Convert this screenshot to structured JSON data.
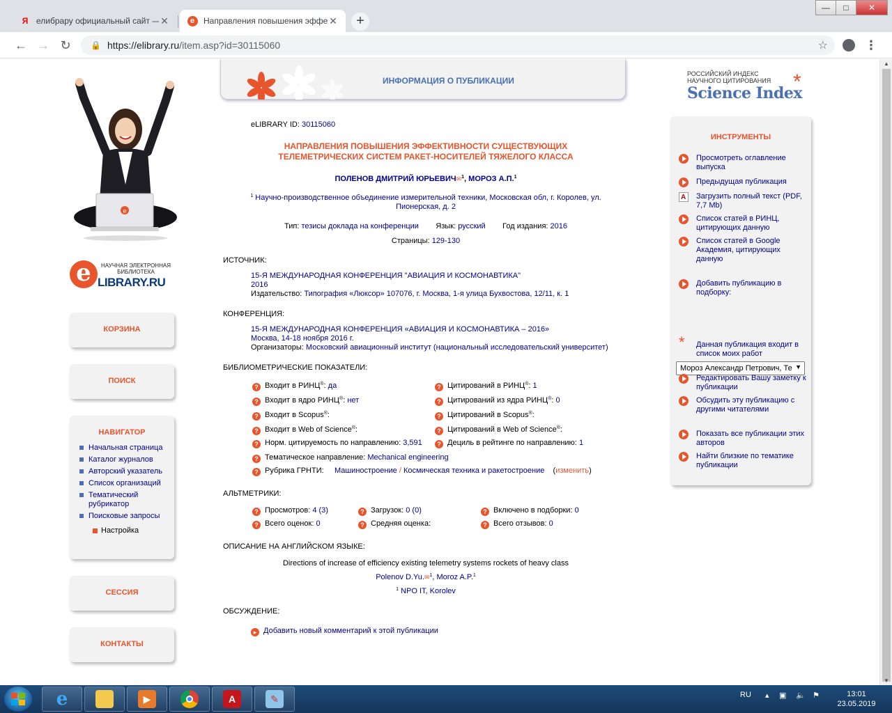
{
  "browser": {
    "tabs": [
      {
        "title": "елибрару официальный сайт — Ян",
        "favicon": "yandex-icon",
        "active": false
      },
      {
        "title": "Направления повышения эффекти",
        "favicon": "elibrary-icon",
        "active": true
      }
    ],
    "new_tab": "+",
    "url_host": "https://elibrary.ru",
    "url_path": "/item.asp?id=30115060",
    "window_controls": {
      "minimize": "—",
      "maximize": "□",
      "close": "✕"
    }
  },
  "left": {
    "logo_small": "НАУЧНАЯ ЭЛЕКТРОННАЯ БИБЛИОТЕКА",
    "logo_letter": "e",
    "logo_big": "LIBRARY.RU",
    "cart": "КОРЗИНА",
    "search": "ПОИСК",
    "navigator": {
      "title": "НАВИГАТОР",
      "items": [
        "Начальная страница",
        "Каталог журналов",
        "Авторский указатель",
        "Список организаций",
        "Тематический рубрикатор",
        "Поисковые запросы"
      ],
      "settings": "Настройка"
    },
    "session": "СЕССИЯ",
    "contacts": "КОНТАКТЫ"
  },
  "header": {
    "title": "ИНФОРМАЦИЯ О ПУБЛИКАЦИИ"
  },
  "publication": {
    "id_label": "eLIBRARY ID:",
    "id": "30115060",
    "title_line1": "НАПРАВЛЕНИЯ ПОВЫШЕНИЯ ЭФФЕКТИВНОСТИ СУЩЕСТВУЮЩИХ",
    "title_line2": "ТЕЛЕМЕТРИЧЕСКИХ СИСТЕМ РАКЕТ-НОСИТЕЛЕЙ ТЯЖЕЛОГО КЛАССА",
    "author1": "ПОЛЕНОВ ДМИТРИЙ ЮРЬЕВИЧ",
    "author1_sup": "1",
    "author2": "МОРОЗ А.П.",
    "author2_sup": "1",
    "affil_sup": "1",
    "affil_line1": "Научно-производственное объединение измерительной техники, Московская обл, г. Королев, ул.",
    "affil_line2": "Пионерская, д. 2",
    "type_label": "Тип:",
    "type": "тезисы доклада на конференции",
    "lang_label": "Язык:",
    "lang": "русский",
    "year_label": "Год издания:",
    "year": "2016",
    "pages_label": "Страницы:",
    "pages": "129-130"
  },
  "source": {
    "heading": "ИСТОЧНИК:",
    "name": "15-Я МЕЖДУНАРОДНАЯ КОНФЕРЕНЦИЯ \"АВИАЦИЯ И КОСМОНАВТИКА\"",
    "year": "2016",
    "publisher_label": "Издательство:",
    "publisher": "Типография «Люксор» 107076, г. Москва, 1-я улица Бухвостова, 12/11, к. 1"
  },
  "conference": {
    "heading": "КОНФЕРЕНЦИЯ:",
    "name": "15-Я МЕЖДУНАРОДНАЯ КОНФЕРЕНЦИЯ «АВИАЦИЯ И КОСМОНАВТИКА – 2016»",
    "place": "Москва, 14-18 ноября 2016 г.",
    "org_label": "Организаторы:",
    "org": "Московский авиационный институт (национальный исследовательский университет)"
  },
  "biblio": {
    "heading": "БИБЛИОМЕТРИЧЕСКИЕ ПОКАЗАТЕЛИ:",
    "left": [
      {
        "label": "Входит в РИНЦ",
        "sup": "®",
        "value": "да"
      },
      {
        "label": "Входит в ядро РИНЦ",
        "sup": "®",
        "value": "нет"
      },
      {
        "label": "Входит в Scopus",
        "sup": "®",
        "value": ""
      },
      {
        "label": "Входит в Web of Science",
        "sup": "®",
        "value": ""
      },
      {
        "label": "Норм. цитируемость по направлению:",
        "sup": "",
        "value": "3,591"
      }
    ],
    "right": [
      {
        "label": "Цитирований в РИНЦ",
        "sup": "®",
        "value": "1"
      },
      {
        "label": "Цитирований из ядра РИНЦ",
        "sup": "®",
        "value": "0"
      },
      {
        "label": "Цитирований в Scopus",
        "sup": "®",
        "value": ""
      },
      {
        "label": "Цитирований в Web of Science",
        "sup": "®",
        "value": ""
      },
      {
        "label": "Дециль в рейтинге по направлению:",
        "sup": "",
        "value": "1"
      }
    ],
    "theme_label": "Тематическое направление:",
    "theme": "Mechanical engineering",
    "grnti_label": "Рубрика ГРНТИ:",
    "grnti1": "Машиностроение",
    "grnti_sep": "/",
    "grnti2": "Космическая техника и ракетостроение",
    "change": "изменить"
  },
  "altmetrics": {
    "heading": "АЛЬТМЕТРИКИ:",
    "views_label": "Просмотров:",
    "views": "4 (3)",
    "downloads_label": "Загрузок:",
    "downloads": "0 (0)",
    "collections_label": "Включено в подборки:",
    "collections": "0",
    "ratings_label": "Всего оценок:",
    "ratings": "0",
    "avg_label": "Средняя оценка:",
    "avg": "",
    "reviews_label": "Всего отзывов:",
    "reviews": "0"
  },
  "english": {
    "heading": "ОПИСАНИЕ НА АНГЛИЙСКОМ ЯЗЫКЕ:",
    "title": "Directions of increase of efficiency existing telemetry systems rockets of heavy class",
    "author1": "Polenov D.Yu.",
    "author1_sup": "1",
    "author2": "Moroz A.P.",
    "author2_sup": "1",
    "affil_sup": "1",
    "affil": "NPO IT, Korolev"
  },
  "discussion": {
    "heading": "ОБСУЖДЕНИЕ:",
    "add": "Добавить новый комментарий к этой публикации"
  },
  "science_index": {
    "line1": "РОССИЙСКИЙ ИНДЕКС",
    "line2": "НАУЧНОГО ЦИТИРОВАНИЯ",
    "brand": "Science Index"
  },
  "tools": {
    "heading": "ИНСТРУМЕНТЫ",
    "toc": "Просмотреть оглавление выпуска",
    "prev": "Предыдущая публикация",
    "fulltext": "Загрузить полный текст (PDF, 7,7 Mb)",
    "rinc_cites": "Список статей в РИНЦ, цитирующих данную",
    "google_cites": "Список статей в Google Академия, цитирующих данную",
    "add_collection": "Добавить публикацию в подборку:",
    "collection_select": "Мороз Александр Петрович, Те",
    "my_works": "Данная публикация входит в список моих работ",
    "edit_note": "Редактировать Вашу заметку к публикации",
    "discuss": "Обсудить эту публикацию с другими читателями",
    "all_by_authors": "Показать все публикации этих авторов",
    "similar": "Найти близкие по тематике публикации"
  },
  "taskbar": {
    "lang": "RU",
    "time": "13:01",
    "date": "23.05.2019"
  }
}
